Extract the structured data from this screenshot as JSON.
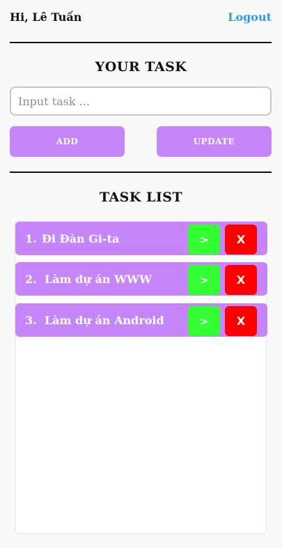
{
  "header": {
    "greeting": "Hi, Lê Tuấn",
    "logout_label": "Logout"
  },
  "form": {
    "title": "YOUR TASK",
    "input_placeholder": "Input task ...",
    "input_value": "",
    "add_label": "ADD",
    "update_label": "UPDATE"
  },
  "list": {
    "title": "TASK LIST",
    "items": [
      {
        "num": "1.",
        "text": "Đi Đàn Gi-ta",
        "go_label": ">",
        "delete_label": "X"
      },
      {
        "num": "2.",
        "text": "Làm dự án WWW",
        "go_label": ">",
        "delete_label": "X"
      },
      {
        "num": "3.",
        "text": "Làm dự án Android",
        "go_label": ">",
        "delete_label": "X"
      }
    ]
  },
  "colors": {
    "accent": "#c785fc",
    "go": "#33ff33",
    "delete": "#ff0000",
    "link": "#2e9be6"
  }
}
